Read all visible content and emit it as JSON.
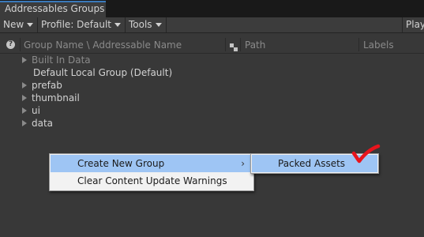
{
  "window": {
    "tab_title": "Addressables Groups"
  },
  "toolbar": {
    "new_label": "New",
    "profile_label": "Profile: Default",
    "tools_label": "Tools",
    "play_label": "Play"
  },
  "header": {
    "help_glyph": "?",
    "group_name": "Group Name \\ Addressable Name",
    "path": "Path",
    "labels": "Labels"
  },
  "groups": [
    {
      "label": "Built In Data",
      "expandable": true,
      "dimmed": true
    },
    {
      "label": "Default Local Group (Default)",
      "expandable": false,
      "dimmed": false
    },
    {
      "label": "prefab",
      "expandable": true,
      "dimmed": false
    },
    {
      "label": "thumbnail",
      "expandable": true,
      "dimmed": false
    },
    {
      "label": "ui",
      "expandable": true,
      "dimmed": false
    },
    {
      "label": "data",
      "expandable": true,
      "dimmed": false
    }
  ],
  "context_menu": {
    "items": [
      {
        "label": "Create New Group",
        "submenu": true,
        "highlighted": true
      },
      {
        "label": "Clear Content Update Warnings",
        "submenu": false,
        "highlighted": false
      }
    ],
    "submenu_arrow": "›"
  },
  "submenu": {
    "items": [
      {
        "label": "Packed Assets",
        "highlighted": true
      }
    ]
  },
  "annotation": {
    "checkmark_color": "#e8141c"
  },
  "colors": {
    "accent": "#3a79bb",
    "menu_highlight": "#9ec5f4"
  }
}
